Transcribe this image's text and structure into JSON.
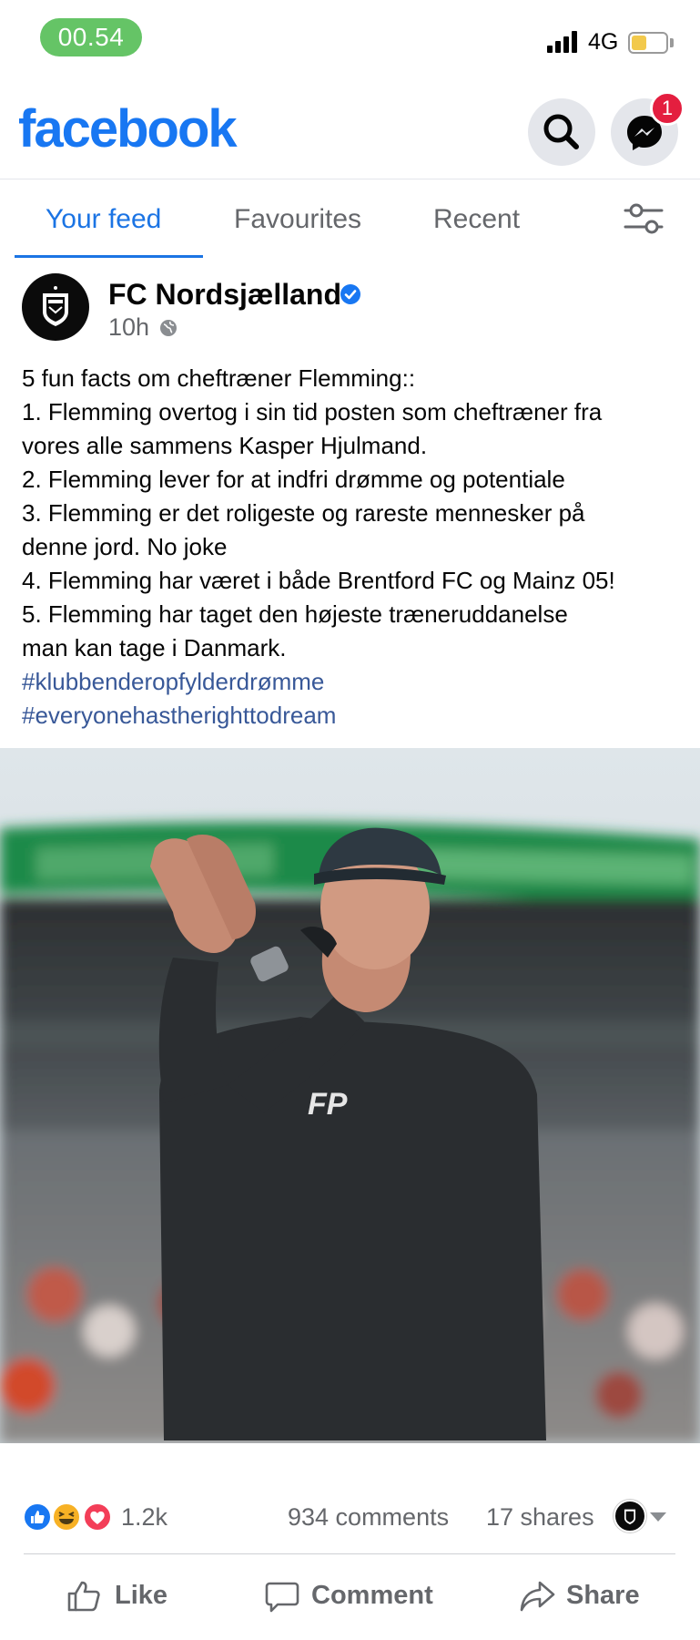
{
  "status_bar": {
    "time": "00.54",
    "network": "4G",
    "battery_level": 0.45
  },
  "header": {
    "logo": "facebook",
    "messenger_badge": "1"
  },
  "tabs": [
    {
      "label": "Your feed",
      "active": true
    },
    {
      "label": "Favourites",
      "active": false
    },
    {
      "label": "Recent",
      "active": false
    }
  ],
  "post": {
    "author": "FC Nordsjælland",
    "timestamp": "10h",
    "lines": [
      "5 fun facts om cheftræner Flemming::",
      "1. Flemming overtog i sin tid posten som cheftræner fra",
      "vores alle sammens Kasper Hjulmand.",
      "2. Flemming lever for at indfri drømme og potentiale",
      "3. Flemming er det roligeste og rareste mennesker på",
      "denne jord. No joke",
      "4. Flemming har været i både Brentford FC og Mainz 05!",
      "5. Flemming har taget den højeste træneruddanelse",
      "man kan tage i Danmark."
    ],
    "hashtags": [
      "#klubbenderopfylderdrømme",
      "#everyonehastherighttodream"
    ],
    "photo_monogram": "FP"
  },
  "engagement": {
    "reactions": "1.2k",
    "comments": "934 comments",
    "shares": "17 shares"
  },
  "actions": {
    "like": "Like",
    "comment": "Comment",
    "share": "Share"
  },
  "colors": {
    "brand": "#1877f2",
    "active_tab": "#1b74e4",
    "hashtag": "#385898",
    "badge": "#e41e3f",
    "time_pill": "#65c466"
  }
}
